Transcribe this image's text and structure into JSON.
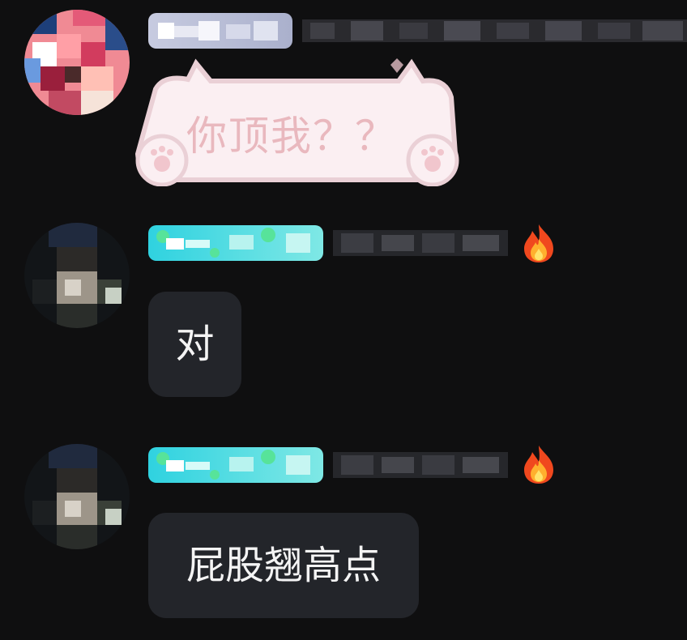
{
  "messages": [
    {
      "sender": "user-a",
      "avatar_icon": "pink-hair-avatar-pixelated",
      "badge_colors": [
        "#c7cbe0",
        "#aab0cc"
      ],
      "bubble_style": "cat-sticker-bubble",
      "text": "你顶我？？",
      "text_color": "#e9b8be"
    },
    {
      "sender": "user-b",
      "avatar_icon": "dark-avatar-pixelated",
      "badge_colors": [
        "#2fd2e0",
        "#7fe8e5"
      ],
      "level_icon": "fire-icon",
      "text": "对"
    },
    {
      "sender": "user-b",
      "avatar_icon": "dark-avatar-pixelated",
      "badge_colors": [
        "#2fd2e0",
        "#7fe8e5"
      ],
      "level_icon": "fire-icon",
      "text": "屁股翘高点"
    }
  ],
  "theme": {
    "background": "#0f0f10",
    "bubble": "#23252a",
    "bubble_text": "#f4f4f4"
  }
}
